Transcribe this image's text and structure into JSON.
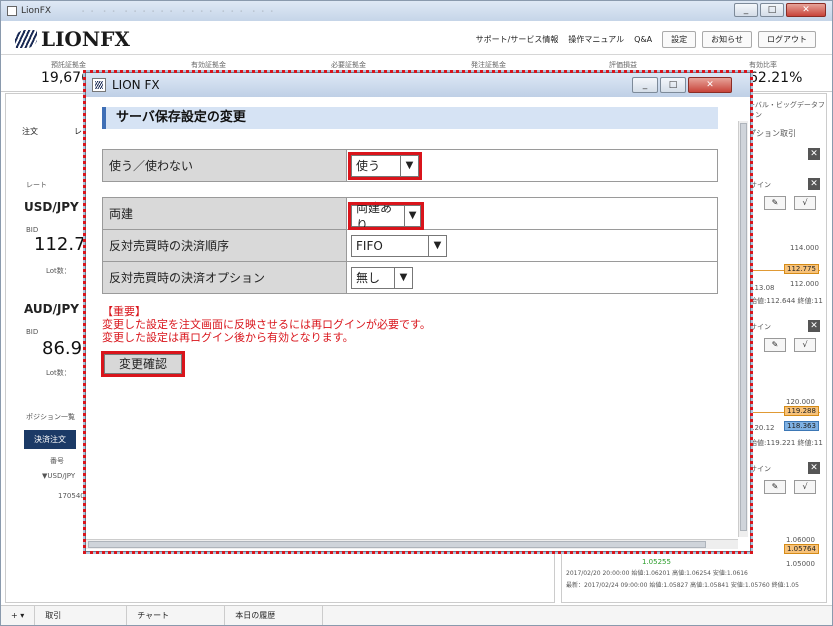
{
  "window": {
    "title": "LionFX",
    "blurred_tabs": "・・ ・・ ・・・・・・ ・・・・ ・・・ ・・・"
  },
  "app": {
    "logo": "LIONFX",
    "links": [
      "サポート/サービス情報",
      "操作マニュアル",
      "Q&A"
    ],
    "buttons": [
      "設定",
      "お知らせ",
      "ログアウト"
    ]
  },
  "summary": [
    {
      "label": "預託証拠金",
      "value": "19,676"
    },
    {
      "label": "有効証拠金",
      "value": ""
    },
    {
      "label": "必要証拠金",
      "value": ""
    },
    {
      "label": "発注証拠金",
      "value": ""
    },
    {
      "label": "評価損益",
      "value": ""
    },
    {
      "label": "有効比率",
      "value": "62.21%"
    }
  ],
  "background": {
    "order_label": "注文",
    "order_label2": "レ",
    "rate_label": "レート",
    "pair1": "USD/JPY",
    "pair1_bid_label": "BID",
    "pair1_bid": "112.77",
    "lot_label": "Lot数：",
    "pair2": "AUD/JPY",
    "pair2_bid": "86.90",
    "positions_label": "ポジション一覧",
    "settle_button": "決済注文",
    "col_number": "番号",
    "group_usdjpy": "▼USD/JPY",
    "row_number": "170540",
    "right_tab": "ーバル・ビッグデータファン",
    "option_label": "プション取引",
    "sign_label": "サイン",
    "chart_prices": [
      "114.000",
      "112.775",
      "112.000",
      "113.08",
      "120.000",
      "119.288",
      "118.363",
      "120.12",
      "1.06000",
      "1.05764",
      "1.05000"
    ],
    "chart_row1": "始値:112.644 終値:11",
    "chart_row2": "始値:119.221 終値:11",
    "chart_info1": "2017/02/20 20:00:00 始値:1.06201 高値:1.06254 安値:1.0616",
    "chart_info2": "最新：2017/02/24 09:00:00 始値:1.05827 高値:1.05841 安値:1.05760 終値:1.05",
    "chart_small1": "1.05255"
  },
  "bottom_tabs": [
    "+ ▾",
    "取引",
    "チャート",
    "本日の履歴"
  ],
  "dialog": {
    "title": "LION FX",
    "section_title": "サーバ保存設定の変更",
    "rows1": [
      {
        "label": "使う／使わない",
        "value": "使う",
        "highlight": true
      }
    ],
    "rows2": [
      {
        "label": "両建",
        "value": "両建あり",
        "highlight": true
      },
      {
        "label": "反対売買時の決済順序",
        "value": "FIFO",
        "highlight": false
      },
      {
        "label": "反対売買時の決済オプション",
        "value": "無し",
        "highlight": false
      }
    ],
    "notice_title": "【重要】",
    "notice_line1": "変更した設定を注文画面に反映させるには再ログインが必要です。",
    "notice_line2": "変更した設定は再ログイン後から有効となります。",
    "confirm_button": "変更確認"
  },
  "colors": {
    "highlight_red": "#d9141b",
    "section_bg": "#d6e3f4",
    "label_bg": "#d9d9d9"
  }
}
